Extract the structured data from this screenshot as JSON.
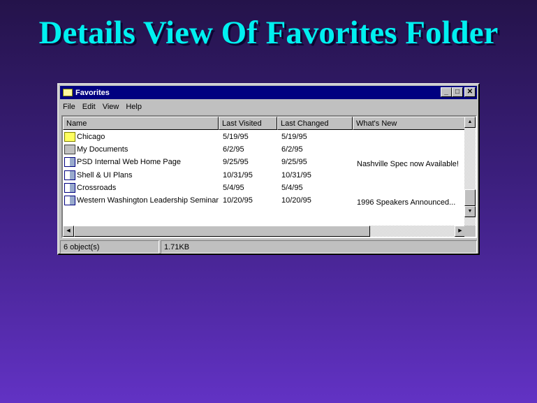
{
  "slide_title": "Details View Of Favorites Folder",
  "window": {
    "title": "Favorites",
    "buttons": {
      "minimize": "_",
      "maximize": "□",
      "close": "✕"
    }
  },
  "menu": [
    {
      "label": "File",
      "key": "F"
    },
    {
      "label": "Edit",
      "key": "E"
    },
    {
      "label": "View",
      "key": "V"
    },
    {
      "label": "Help",
      "key": "H"
    }
  ],
  "columns": [
    "Name",
    "Last Visited",
    "Last Changed",
    "What's New"
  ],
  "rows": [
    {
      "icon": "folder-shortcut-icon",
      "name": "Chicago",
      "visited": "5/19/95",
      "changed": "5/19/95",
      "new": ""
    },
    {
      "icon": "drive-shortcut-icon",
      "name": "My Documents",
      "visited": "6/2/95",
      "changed": "6/2/95",
      "new": ""
    },
    {
      "icon": "internet-shortcut-icon",
      "name": "PSD Internal Web Home Page",
      "visited": "9/25/95",
      "changed": "9/25/95",
      "new": "Nashville Spec now Available!"
    },
    {
      "icon": "internet-shortcut-icon",
      "name": "Shell & UI Plans",
      "visited": "10/31/95",
      "changed": "10/31/95",
      "new": ""
    },
    {
      "icon": "internet-shortcut-icon",
      "name": "Crossroads",
      "visited": "5/4/95",
      "changed": "5/4/95",
      "new": ""
    },
    {
      "icon": "internet-shortcut-icon",
      "name": "Western Washington Leadership Seminar",
      "visited": "10/20/95",
      "changed": "10/20/95",
      "new": "1996 Speakers Announced..."
    }
  ],
  "status": {
    "objects": "6 object(s)",
    "size": "1.71KB"
  }
}
